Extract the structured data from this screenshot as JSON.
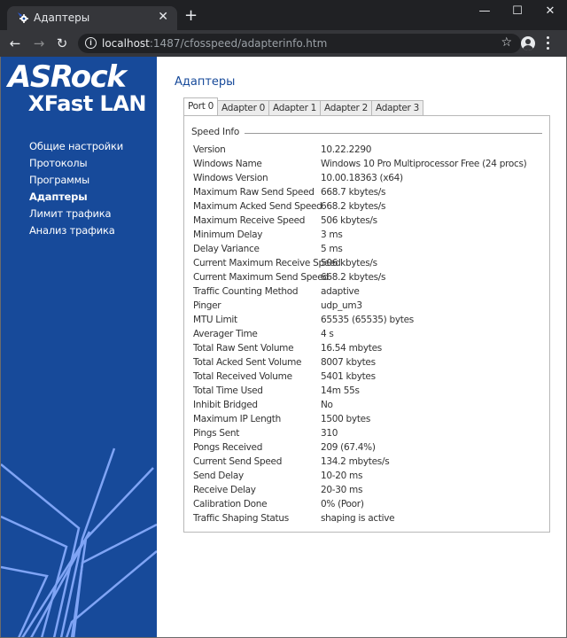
{
  "browser": {
    "tab_title": "Адаптеры",
    "tab_close": "✕",
    "new_tab": "+",
    "window_controls": {
      "minimize": "—",
      "maximize": "☐",
      "close": "✕"
    },
    "nav": {
      "back": "←",
      "forward": "→",
      "reload": "↻"
    },
    "url_host": "localhost",
    "url_rest": ":1487/cfosspeed/adapterinfo.htm",
    "star": "☆",
    "icons": {
      "favicon": "gear-icon",
      "info": "info-icon",
      "star": "star-icon",
      "profile": "profile-icon",
      "menu": "kebab-menu-icon"
    }
  },
  "sidebar": {
    "logo_brand": "ASRock",
    "logo_product": "XFast LAN",
    "items": [
      {
        "label": "Общие настройки",
        "active": false
      },
      {
        "label": "Протоколы",
        "active": false
      },
      {
        "label": "Программы",
        "active": false
      },
      {
        "label": "Адаптеры",
        "active": true
      },
      {
        "label": "Лимит трафика",
        "active": false
      },
      {
        "label": "Анализ трафика",
        "active": false
      }
    ]
  },
  "main": {
    "title": "Адаптеры",
    "tabs": [
      {
        "label": "Port 0",
        "active": true
      },
      {
        "label": "Adapter 0",
        "active": false
      },
      {
        "label": "Adapter 1",
        "active": false
      },
      {
        "label": "Adapter 2",
        "active": false
      },
      {
        "label": "Adapter 3",
        "active": false
      }
    ],
    "section_title": "Speed Info",
    "rows": [
      {
        "key": "Version",
        "value": "10.22.2290"
      },
      {
        "key": "Windows Name",
        "value": "Windows 10 Pro Multiprocessor Free (24 procs)"
      },
      {
        "key": "Windows Version",
        "value": "10.00.18363 (x64)"
      },
      {
        "key": "Maximum Raw Send Speed",
        "value": "668.7 kbytes/s"
      },
      {
        "key": "Maximum Acked Send Speed",
        "value": "668.2 kbytes/s"
      },
      {
        "key": "Maximum Receive Speed",
        "value": "506 kbytes/s"
      },
      {
        "key": "Minimum Delay",
        "value": "3 ms"
      },
      {
        "key": "Delay Variance",
        "value": "5 ms"
      },
      {
        "key": "Current Maximum Receive Speed",
        "value": "506 kbytes/s"
      },
      {
        "key": "Current Maximum Send Speed",
        "value": "668.2 kbytes/s"
      },
      {
        "key": "Traffic Counting Method",
        "value": "adaptive"
      },
      {
        "key": "Pinger",
        "value": "udp_um3"
      },
      {
        "key": "MTU Limit",
        "value": "65535 (65535) bytes"
      },
      {
        "key": "Averager Time",
        "value": "4 s"
      },
      {
        "key": "Total Raw Sent Volume",
        "value": "16.54 mbytes"
      },
      {
        "key": "Total Acked Sent Volume",
        "value": "8007 kbytes"
      },
      {
        "key": "Total Received Volume",
        "value": "5401 kbytes"
      },
      {
        "key": "Total Time Used",
        "value": "14m 55s"
      },
      {
        "key": "Inhibit Bridged",
        "value": "No"
      },
      {
        "key": "Maximum IP Length",
        "value": "1500 bytes"
      },
      {
        "key": "Pings Sent",
        "value": "310"
      },
      {
        "key": "Pongs Received",
        "value": "209 (67.4%)"
      },
      {
        "key": "Current Send Speed",
        "value": "134.2 mbytes/s"
      },
      {
        "key": "Send Delay",
        "value": "10-20 ms"
      },
      {
        "key": "Receive Delay",
        "value": "20-30 ms"
      },
      {
        "key": "Calibration Done",
        "value": "0% (Poor)"
      },
      {
        "key": "Traffic Shaping Status",
        "value": "shaping is active"
      }
    ]
  },
  "colors": {
    "sidebar_bg": "#174a9a",
    "sidebar_lines": "#7fa4f5",
    "title_blue": "#174a9a",
    "chrome_dark": "#202124",
    "chrome_toolbar": "#35363a"
  }
}
